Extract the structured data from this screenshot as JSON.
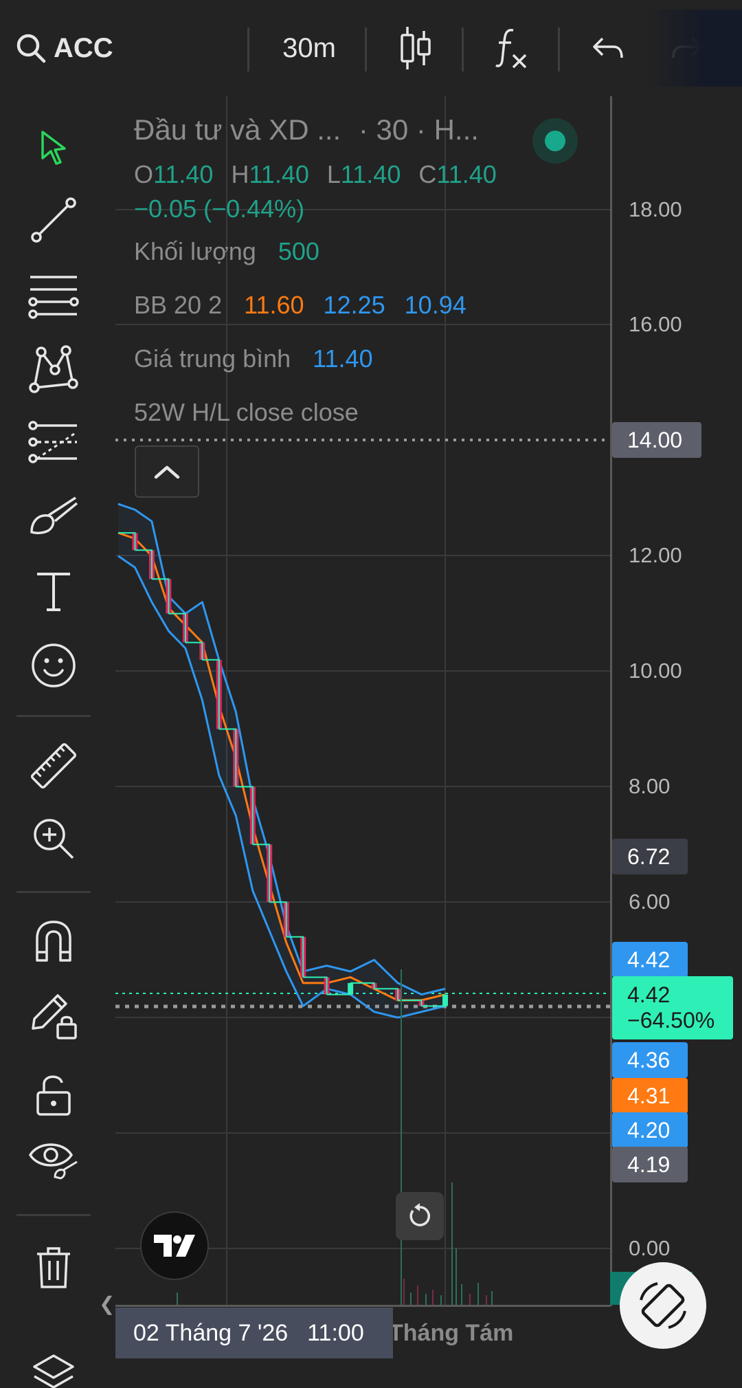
{
  "toolbar": {
    "symbol": "ACC",
    "interval": "30m",
    "icons": [
      "search-icon",
      "candles-icon",
      "indicators-icon",
      "undo-icon",
      "redo-icon"
    ]
  },
  "legend": {
    "title": "Đầu tư và XD ...",
    "title_suffix": "· 30 · H...",
    "ohlc": {
      "o_label": "O",
      "o": "11.40",
      "h_label": "H",
      "h": "11.40",
      "l_label": "L",
      "l": "11.40",
      "c_label": "C",
      "c": "11.40",
      "change": "−0.05 (−0.44%)"
    },
    "volume": {
      "label": "Khối lượng",
      "value": "500"
    },
    "bb": {
      "label": "BB 20 2",
      "mid": "11.60",
      "upper": "12.25",
      "lower": "10.94"
    },
    "avg_price": {
      "label": "Giá trung bình",
      "value": "11.40"
    },
    "hl": {
      "label": "52W H/L close close"
    }
  },
  "price_axis": {
    "ticks": [
      "18.00",
      "16.00",
      "14.00",
      "12.00",
      "10.00",
      "8.00",
      "6.00",
      "0.00"
    ],
    "labels": {
      "hl_line": "14.00",
      "crosshair": "6.72",
      "bb_upper": "4.42",
      "last_price": "4.42",
      "last_change": "−64.50%",
      "avg_price": "4.36",
      "bb_mid": "4.31",
      "bb_lower": "4.20",
      "prev_close": "4.19"
    }
  },
  "time_axis": {
    "cursor_date": "02 Tháng 7 '26",
    "cursor_time": "11:00",
    "month_label": "Tháng Tám"
  },
  "colors": {
    "background": "#232323",
    "up": "#2ef0b6",
    "down": "#e0245e",
    "bb_band": "#2f97f0",
    "bb_mid": "#ff7a12",
    "accent_green": "#1fa28b",
    "axis_label": "#5d606b"
  },
  "chart_data": {
    "type": "candlestick",
    "ylim": [
      0,
      19
    ],
    "bb_period": 20,
    "bb_stddev": 2,
    "close": [
      12.4,
      12.1,
      11.6,
      11.0,
      10.5,
      10.2,
      9.0,
      8.0,
      7.0,
      6.0,
      5.4,
      4.7,
      4.4,
      4.6,
      4.5,
      4.3,
      4.2,
      4.4
    ],
    "bb_upper": [
      12.9,
      12.8,
      12.6,
      11.3,
      11.0,
      11.2,
      10.2,
      9.3,
      7.8,
      6.8,
      5.6,
      4.8,
      4.9,
      4.8,
      5.0,
      4.6,
      4.4,
      4.5
    ],
    "bb_mid": [
      12.4,
      12.3,
      12.0,
      11.1,
      10.8,
      10.5,
      9.4,
      8.5,
      7.3,
      6.3,
      5.3,
      4.6,
      4.6,
      4.7,
      4.5,
      4.3,
      4.3,
      4.4
    ],
    "bb_lower": [
      12.0,
      11.8,
      11.2,
      10.7,
      10.4,
      9.5,
      8.2,
      7.5,
      6.2,
      5.5,
      4.8,
      4.2,
      4.5,
      4.4,
      4.1,
      4.0,
      4.1,
      4.2
    ],
    "last_price": 4.42,
    "hl_level": 14.0,
    "prev_close": 4.19
  }
}
